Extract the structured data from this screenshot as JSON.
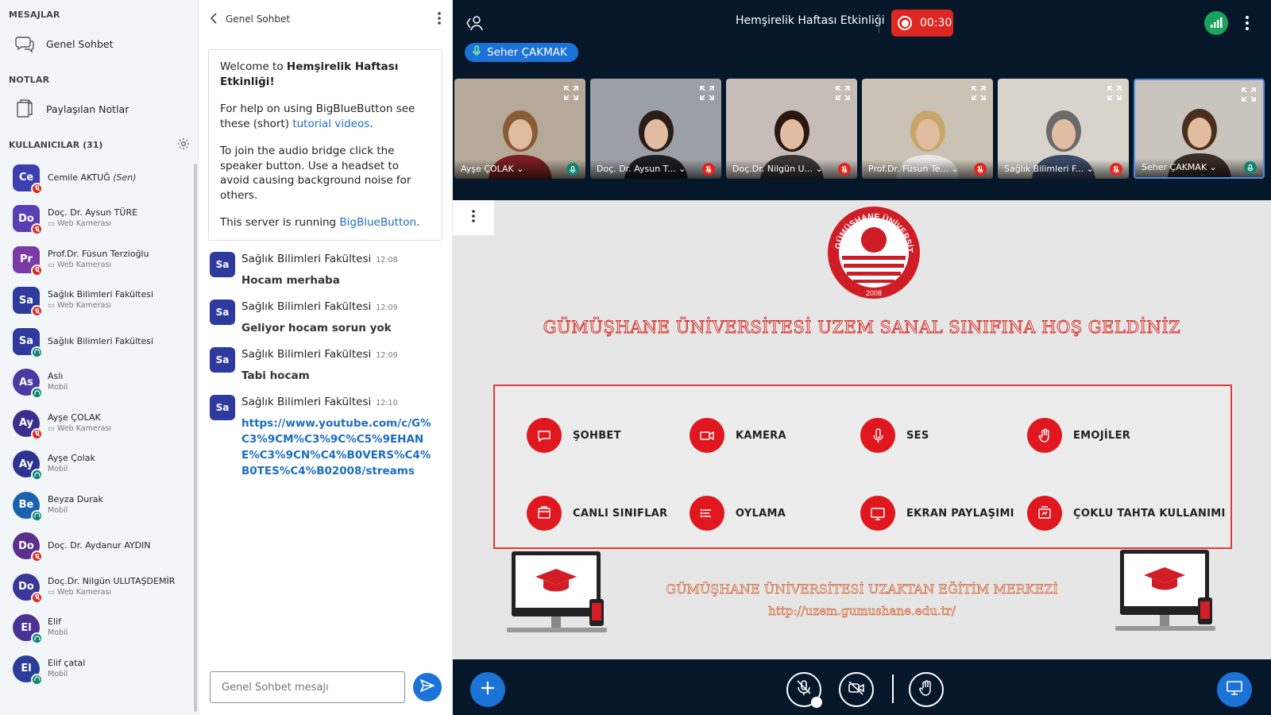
{
  "sidebar": {
    "messages_title": "MESAJLAR",
    "public_chat_label": "Genel Sohbet",
    "notes_title": "NOTLAR",
    "shared_notes_label": "Paylaşılan Notlar",
    "users_title": "KULLANICILAR (31)",
    "users": [
      {
        "initials": "Ce",
        "name": "Cemile AKTUĞ",
        "you": "(Sen)",
        "sub": "",
        "color": "#3b3fb0",
        "shape": "square",
        "badge": "red"
      },
      {
        "initials": "Do",
        "name": "Doç. Dr. Aysun TÜRE",
        "sub": "Web Kamerası",
        "color": "#5a3fb4",
        "shape": "square",
        "badge": "red"
      },
      {
        "initials": "Pr",
        "name": "Prof.Dr. Füsun Terzioğlu",
        "sub": "Web Kamerası",
        "color": "#7a3aa6",
        "shape": "square",
        "badge": "red"
      },
      {
        "initials": "Sa",
        "name": "Sağlık Bilimleri Fakültesi",
        "sub": "Web Kamerası",
        "color": "#2e3a9e",
        "shape": "square",
        "badge": "red"
      },
      {
        "initials": "Sa",
        "name": "Sağlık Bilimleri Fakültesi",
        "sub": "",
        "color": "#2e3a9e",
        "shape": "square",
        "badge": "teal"
      },
      {
        "initials": "As",
        "name": "Aslı",
        "sub": "Mobil",
        "color": "#4b3aa0",
        "shape": "round",
        "badge": "teal"
      },
      {
        "initials": "Ay",
        "name": "Ayşe ÇOLAK",
        "sub": "Web Kamerası",
        "color": "#3b2f8e",
        "shape": "round",
        "badge": "red"
      },
      {
        "initials": "Ay",
        "name": "Ayşe Çolak",
        "sub": "Mobil",
        "color": "#2c3390",
        "shape": "round",
        "badge": "teal"
      },
      {
        "initials": "Be",
        "name": "Beyza Durak",
        "sub": "Mobil",
        "color": "#1a62b0",
        "shape": "round",
        "badge": "teal"
      },
      {
        "initials": "Do",
        "name": "Doç. Dr. Aydanur AYDIN",
        "sub": "",
        "color": "#5a2f8e",
        "shape": "round",
        "badge": "red"
      },
      {
        "initials": "Do",
        "name": "Doç.Dr. Nilgün ULUTAŞDEMİR",
        "sub": "Web Kamerası",
        "color": "#3a3798",
        "shape": "round",
        "badge": "red"
      },
      {
        "initials": "El",
        "name": "Elif",
        "sub": "Mobil",
        "color": "#4a3296",
        "shape": "round",
        "badge": "teal"
      },
      {
        "initials": "El",
        "name": "Elif çatal",
        "sub": "Mobil",
        "color": "#2a3c9a",
        "shape": "round",
        "badge": "teal"
      }
    ]
  },
  "chat": {
    "title": "Genel Sohbet",
    "welcome_prefix": "Welcome to ",
    "welcome_name": "Hemşirelik Haftası Etkinliği!",
    "help_text": "For help on using BigBlueButton see these (short) ",
    "help_link": "tutorial videos",
    "help_end": ".",
    "audio_text": "To join the audio bridge click the speaker button. Use a headset to avoid causing background noise for others.",
    "server_text": "This server is running ",
    "server_link": "BigBlueButton",
    "server_end": ".",
    "messages": [
      {
        "initials": "Sa",
        "sender": "Sağlık Bilimleri Fakültesi",
        "time": "12:08",
        "text": "Hocam merhaba"
      },
      {
        "initials": "Sa",
        "sender": "Sağlık Bilimleri Fakültesi",
        "time": "12:09",
        "text": "Geliyor hocam sorun yok"
      },
      {
        "initials": "Sa",
        "sender": "Sağlık Bilimleri Fakültesi",
        "time": "12:09",
        "text": "Tabi hocam"
      },
      {
        "initials": "Sa",
        "sender": "Sağlık Bilimleri Fakültesi",
        "time": "12:10",
        "text": "https://www.youtube.com/c/G%C3%9CM%C3%9C%C5%9EHANE%C3%9CN%C4%B0VERS%C4%B0TES%C4%B02008/streams"
      }
    ],
    "input_placeholder": "Genel Sohbet mesajı"
  },
  "meeting": {
    "title": "Hemşirelik Haftası Etkinliği",
    "recording_time": "00:30",
    "talking_user": "Seher ÇAKMAK"
  },
  "videos": [
    {
      "name": "Ayşe ÇOLAK",
      "muted": false,
      "active": false,
      "bg": "#b5a99a",
      "shirt": "#7a1f1f",
      "hair": "#8a5c34"
    },
    {
      "name": "Doç. Dr. Aysun T...",
      "muted": true,
      "active": false,
      "bg": "#9aa0a6",
      "shirt": "#1d1d22",
      "hair": "#2a1c16"
    },
    {
      "name": "Doç.Dr. Nilgün U...",
      "muted": true,
      "active": false,
      "bg": "#c6bdb8",
      "shirt": "#3a3636",
      "hair": "#2a1712"
    },
    {
      "name": "Prof.Dr. Füsun Te...",
      "muted": true,
      "active": false,
      "bg": "#c9c2b5",
      "shirt": "#e8e6e3",
      "hair": "#c8a66a"
    },
    {
      "name": "Sağlık Bilimleri F...",
      "muted": true,
      "active": false,
      "bg": "#d8d4cc",
      "shirt": "#3b4a66",
      "hair": "#6a6a6a"
    },
    {
      "name": "Seher ÇAKMAK",
      "muted": false,
      "active": true,
      "bg": "#c9c4bd",
      "shirt": "#3a2e28",
      "hair": "#4a2e1c"
    }
  ],
  "slide": {
    "logo_text": "GÜMÜŞHANE ÜNİVERSİTESİ",
    "logo_year": "2008",
    "welcome_banner": "GÜMÜŞHANE ÜNİVERSİTESİ UZEM SANAL SINIFINA HOŞ GELDİNİZ",
    "features": [
      "ŞOHBET",
      "KAMERA",
      "SES",
      "EMOJİLER",
      "CANLI SINIFLAR",
      "OYLAMA",
      "EKRAN PAYLAŞIMI",
      "ÇOKLU TAHTA KULLANIMI"
    ],
    "center_title": "GÜMÜŞHANE ÜNİVERSİTESİ UZAKTAN EĞİTİM MERKEZİ",
    "center_url": "http://uzem.gumushane.edu.tr/"
  },
  "colors": {
    "primary": "#1b73d8",
    "danger": "#df2721",
    "success": "#0f8473",
    "bg_dark": "#06172a"
  }
}
